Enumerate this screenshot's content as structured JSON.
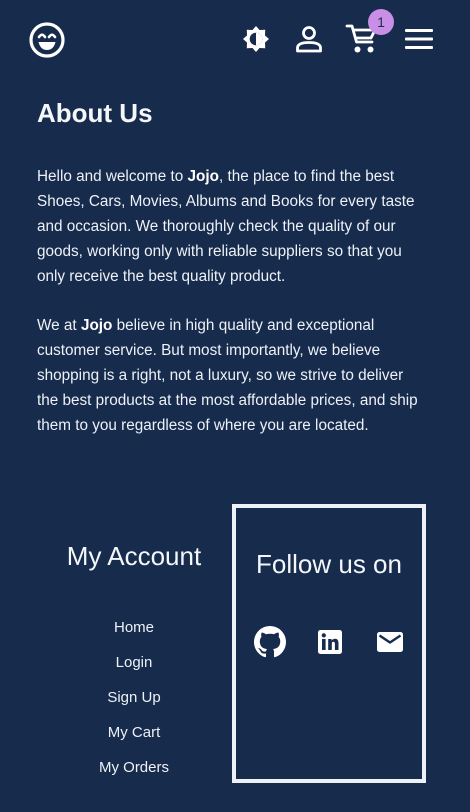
{
  "header": {
    "logo_icon": "smiley-face-icon",
    "theme_toggle_icon": "brightness-icon",
    "profile_icon": "person-icon",
    "cart_icon": "shopping-cart-icon",
    "cart_count": "1",
    "menu_icon": "hamburger-menu-icon"
  },
  "about": {
    "title": "About Us",
    "para1": {
      "before": "Hello and welcome to ",
      "brand": "Jojo",
      "after": ", the place to find the best Shoes, Cars, Movies, Albums and Books for every taste and occasion. We thoroughly check the quality of our goods, working only with reliable suppliers so that you only receive the best quality product."
    },
    "para2": {
      "before": "We at ",
      "brand": "Jojo",
      "after": " believe in high quality and exceptional customer service. But most importantly, we believe shopping is a right, not a luxury, so we strive to deliver the best products at the most affordable prices, and ship them to you regardless of where you are located."
    }
  },
  "footer": {
    "account_title": "My Account",
    "links": [
      "Home",
      "Login",
      "Sign Up",
      "My Cart",
      "My Orders"
    ],
    "follow_title": "Follow us on",
    "social_icons": [
      "github-icon",
      "linkedin-icon",
      "mail-icon"
    ]
  },
  "colors": {
    "background": "#172b4d",
    "text": "#eef1f6",
    "badge": "#c98ee6"
  }
}
